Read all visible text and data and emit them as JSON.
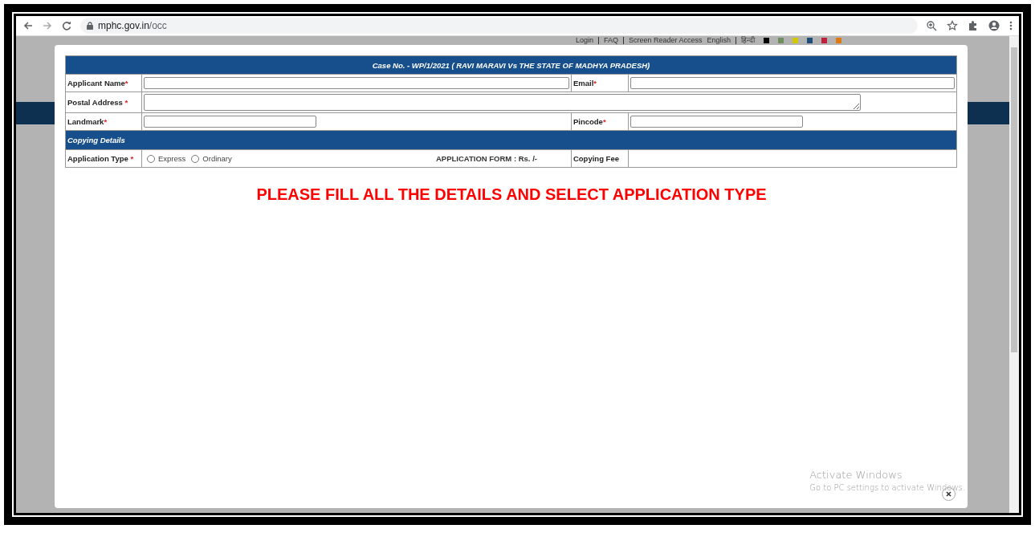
{
  "browser": {
    "url_host": "mphc.gov.in",
    "url_path": "/occ"
  },
  "top_links": [
    {
      "label": "Login"
    },
    {
      "label": "FAQ"
    },
    {
      "label": "Screen Reader Access"
    },
    {
      "label": "English"
    },
    {
      "label": "हिन्दी"
    }
  ],
  "theme_swatches": [
    {
      "color": "#000000"
    },
    {
      "color": "#6f8f5f"
    },
    {
      "color": "#d4c800"
    },
    {
      "color": "#1d4e7a"
    },
    {
      "color": "#c0203a"
    },
    {
      "color": "#e07a10"
    }
  ],
  "form": {
    "title": "Case No. - WP/1/2021 ( RAVI MARAVI Vs THE STATE OF MADHYA PRADESH)",
    "rows": [
      {
        "kind": "pair",
        "cells": [
          {
            "label": "Applicant Name",
            "mark": "*",
            "kind": "wide"
          },
          {
            "label": "Email",
            "mark": "*",
            "kind": "wide"
          }
        ]
      },
      {
        "kind": "address",
        "cells": [
          {
            "label": "Postal Address",
            "mark": " *",
            "kind": "textarea"
          }
        ]
      },
      {
        "kind": "pair",
        "cells": [
          {
            "label": "Landmark",
            "mark": "*",
            "kind": "short"
          },
          {
            "label": "Pincode",
            "mark": "*",
            "kind": "short"
          }
        ]
      },
      {
        "kind": "section",
        "title": "Copying Details"
      },
      {
        "kind": "application",
        "label": "Application Type",
        "mark": " *",
        "options": [
          {
            "label": "Express",
            "selected": false
          },
          {
            "label": "Ordinary",
            "selected": false
          }
        ],
        "form_fee": "APPLICATION FORM : Rs. /-",
        "fee_label": "Copying Fee"
      }
    ]
  },
  "message": "PLEASE FILL ALL THE DETAILS AND SELECT APPLICATION TYPE",
  "os_notice": {
    "title": "Activate Windows",
    "text": "Go to PC settings to activate Windows."
  }
}
